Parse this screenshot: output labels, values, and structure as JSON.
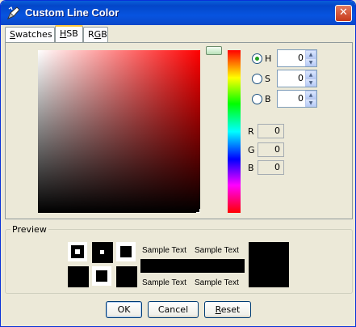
{
  "window": {
    "title": "Custom Line Color",
    "close_glyph": "✕"
  },
  "tabs": [
    {
      "label": "Swatches",
      "mnemonic": "S",
      "rest": "watches",
      "active": false
    },
    {
      "label": "HSB",
      "mnemonic": "H",
      "rest": "SB",
      "active": true
    },
    {
      "label": "RGB",
      "mnemonic": "R",
      "rest": "G",
      "mid": "B",
      "active": false
    }
  ],
  "hsb": {
    "h": {
      "label": "H",
      "value": "0",
      "checked": true
    },
    "s": {
      "label": "S",
      "value": "0",
      "checked": false
    },
    "b": {
      "label": "B",
      "value": "0",
      "checked": false
    }
  },
  "rgb": {
    "r": {
      "label": "R",
      "value": "0"
    },
    "g": {
      "label": "G",
      "value": "0"
    },
    "b": {
      "label": "B",
      "value": "0"
    }
  },
  "preview": {
    "legend": "Preview",
    "sample_text": "Sample Text",
    "color": "#000000"
  },
  "buttons": {
    "ok": "OK",
    "cancel": "Cancel",
    "reset_mnemonic": "R",
    "reset_rest": "eset"
  },
  "colors": {
    "titlebar": "#0a5fd8",
    "selected_hue": "#ff0000",
    "tab_highlight": "#ffc83c"
  },
  "icons": {
    "app": "pen-icon",
    "close": "close-icon",
    "spin_up": "chevron-up-icon",
    "spin_down": "chevron-down-icon"
  }
}
